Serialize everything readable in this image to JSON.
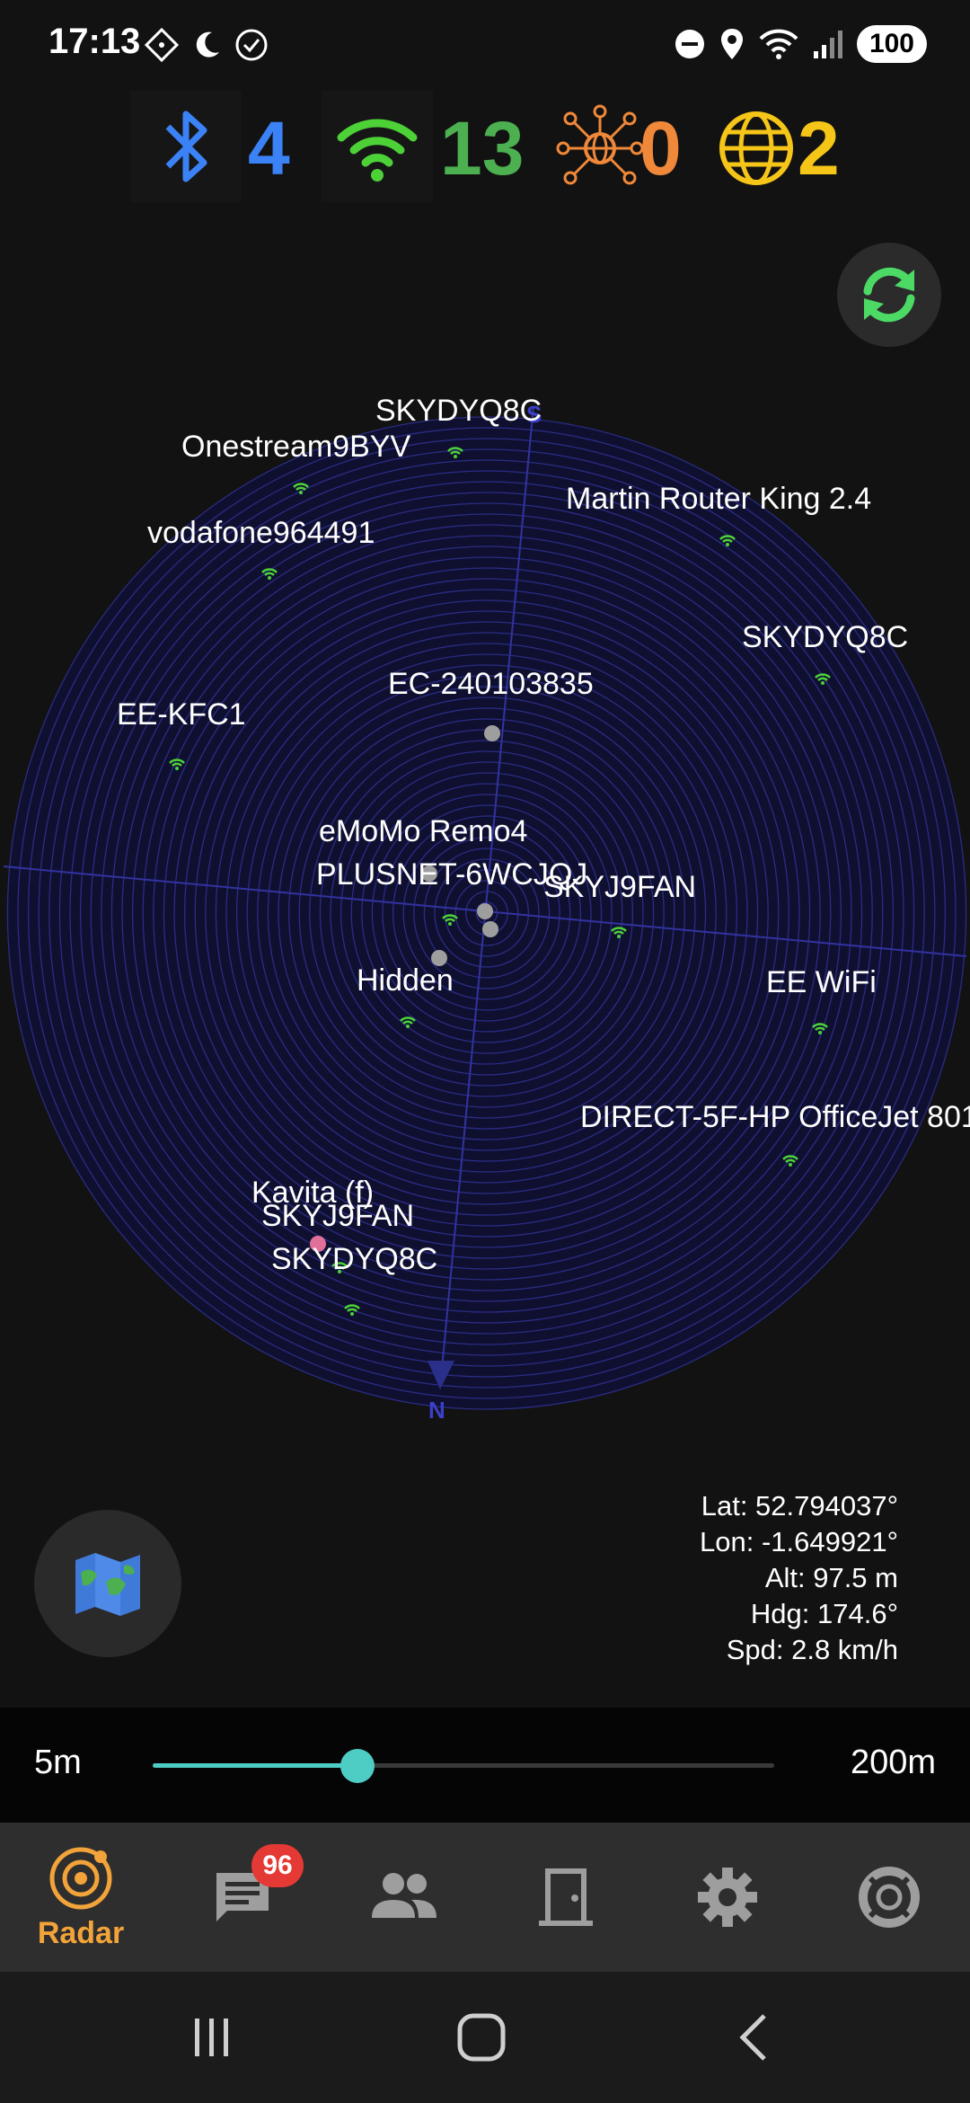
{
  "status_bar": {
    "time": "17:13",
    "battery": "100",
    "icons_left": [
      "dnd-diamond-icon",
      "night-mode-icon",
      "check-circle-icon"
    ],
    "icons_right": [
      "do-not-disturb-icon",
      "location-icon",
      "wifi-icon",
      "signal-icon"
    ]
  },
  "counters": {
    "bluetooth": "4",
    "wifi": "13",
    "mesh": "0",
    "internet": "2",
    "colors": {
      "bluetooth": "#3b82f6",
      "wifi": "#4caf50",
      "mesh": "#f0883a",
      "internet": "#f5c518"
    }
  },
  "radar": {
    "compass": {
      "top": "S",
      "bottom": "N"
    },
    "networks": [
      {
        "label": "SKYDYQ8C",
        "type": "wifi"
      },
      {
        "label": "Onestream9BYV",
        "type": "wifi"
      },
      {
        "label": "Martin Router King 2.4",
        "type": "wifi"
      },
      {
        "label": "vodafone964491",
        "type": "wifi"
      },
      {
        "label": "SKYDYQ8C",
        "type": "wifi"
      },
      {
        "label": "EC-240103835",
        "type": "device"
      },
      {
        "label": "EE-KFC1",
        "type": "wifi"
      },
      {
        "label": "eMoMo Remo4",
        "type": "device"
      },
      {
        "label": "PLUSNET-6WCJQJ",
        "type": "wifi"
      },
      {
        "label": "SKYJ9FAN",
        "type": "wifi"
      },
      {
        "label": "Hidden",
        "type": "wifi"
      },
      {
        "label": "EE WiFi",
        "type": "wifi"
      },
      {
        "label": "DIRECT-5F-HP OfficeJet 801",
        "type": "wifi"
      },
      {
        "label": "Kavita (f)",
        "type": "friend"
      },
      {
        "label": "SKYJ9FAN",
        "type": "wifi"
      },
      {
        "label": "SKYDYQ8C",
        "type": "wifi"
      }
    ]
  },
  "location": {
    "lat": "Lat: 52.794037°",
    "lon": "Lon: -1.649921°",
    "alt": "Alt: 97.5 m",
    "hdg": "Hdg: 174.6°",
    "spd": "Spd: 2.8 km/h"
  },
  "range": {
    "min_label": "5m",
    "max_label": "200m",
    "value_fraction": 0.33
  },
  "nav": {
    "radar_label": "Radar",
    "messages_badge": "96",
    "active_color": "#f2a33a"
  }
}
